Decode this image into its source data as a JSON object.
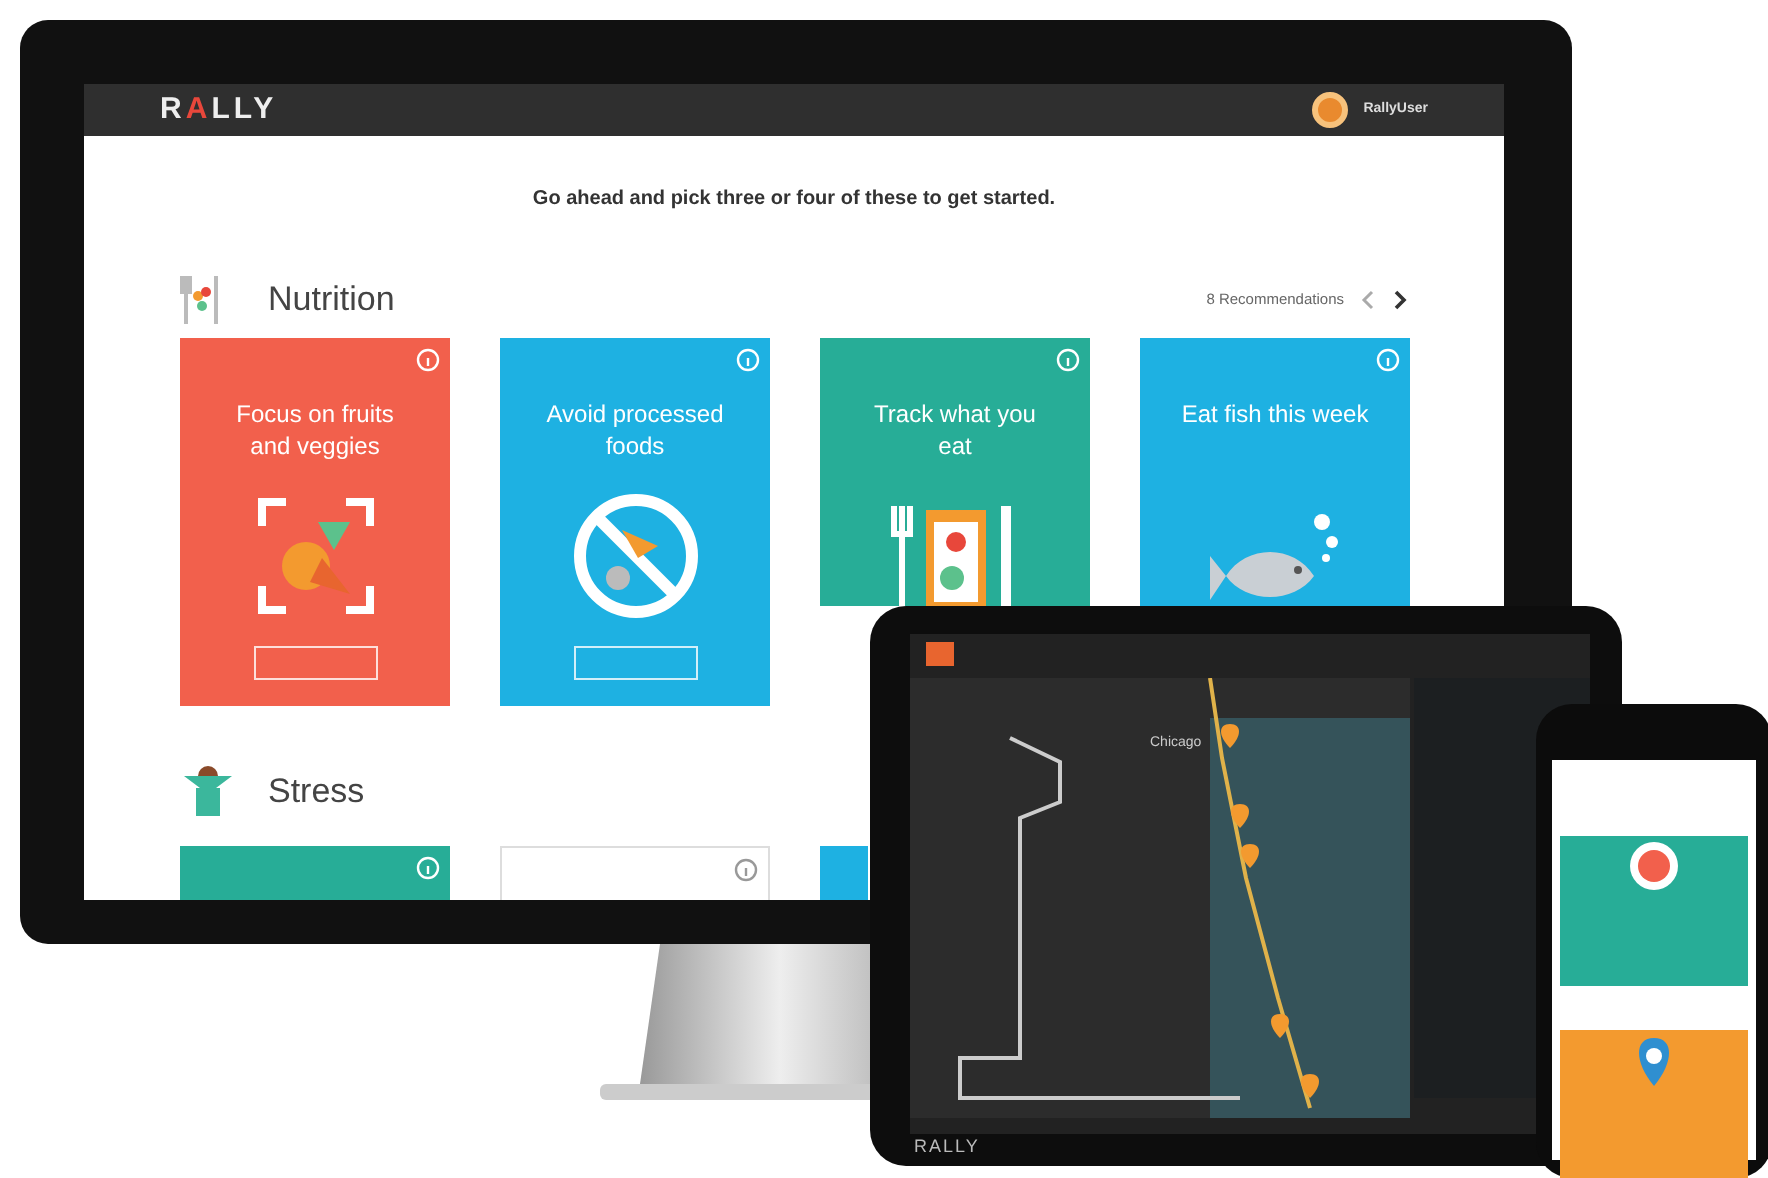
{
  "monitor": {
    "header": {
      "logo": "RALLY",
      "user": "RallyUser"
    },
    "prompt": "Go ahead and pick three or four of these to get started.",
    "sections": [
      {
        "title": "Nutrition",
        "count": "8 Recommendations",
        "cards": [
          {
            "title": "Focus on fruits and veggies",
            "color": "#f2604c",
            "kind": "fruits",
            "button": true
          },
          {
            "title": "Avoid processed foods",
            "color": "#1eb1e2",
            "kind": "noprocessed",
            "button": true
          },
          {
            "title": "Track what you eat",
            "color": "#27ad97",
            "kind": "clipboard",
            "button": false
          },
          {
            "title": "Eat fish this week",
            "color": "#1eb1e2",
            "kind": "fish",
            "button": false
          }
        ]
      },
      {
        "title": "Stress",
        "cards": [
          {
            "color": "#27ad97",
            "kind": "plain"
          },
          {
            "color": "#ffffff",
            "kind": "plain"
          },
          {
            "color": "#1eb1e2",
            "kind": "plain"
          }
        ]
      }
    ]
  },
  "tablet": {
    "map_label": "Chicago",
    "logo": "RALLY"
  },
  "phone": {
    "cards": [
      {
        "color": "#27ad97",
        "kind": "plate"
      },
      {
        "color": "#f39a2f",
        "kind": "pin"
      }
    ]
  }
}
